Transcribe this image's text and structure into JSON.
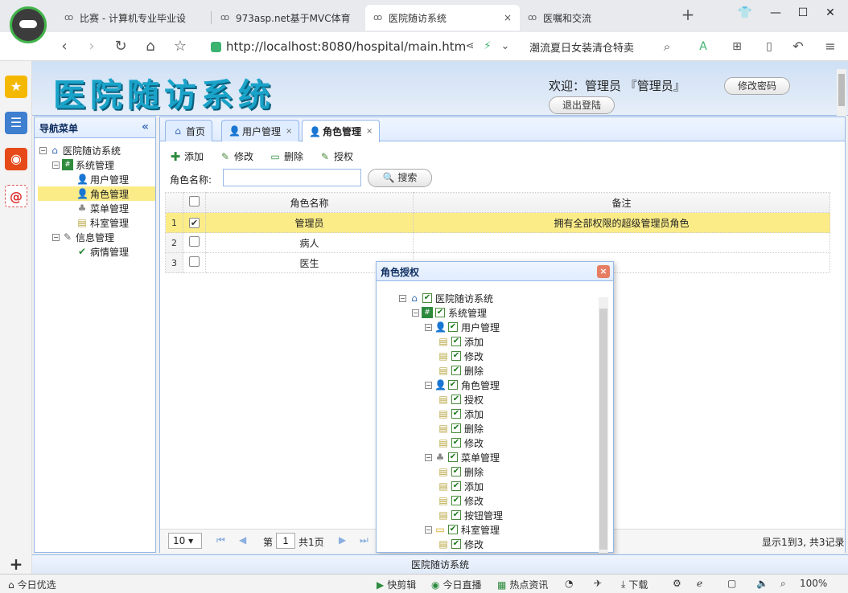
{
  "browser": {
    "tabs": [
      {
        "label": "比赛 - 计算机专业毕业设"
      },
      {
        "label": "973asp.net基于MVC体育"
      },
      {
        "label": "医院随访系统",
        "close": "×"
      },
      {
        "label": "医嘱和交流"
      }
    ],
    "new_tab": "+",
    "url": "http://localhost:8080/hospital/main.htm",
    "promo": "潮流夏日女装清仓特卖"
  },
  "app": {
    "title": "医院随访系统",
    "welcome": "欢迎：管理员 『管理员』",
    "change_password": "修改密码",
    "logout": "退出登陆",
    "footer": "医院随访系统"
  },
  "nav": {
    "header": "导航菜单",
    "collapse": "«",
    "items": [
      {
        "label": "医院随访系统"
      },
      {
        "label": "系统管理"
      },
      {
        "label": "用户管理"
      },
      {
        "label": "角色管理"
      },
      {
        "label": "菜单管理"
      },
      {
        "label": "科室管理"
      },
      {
        "label": "信息管理"
      },
      {
        "label": "病情管理"
      }
    ]
  },
  "main": {
    "tabs": [
      {
        "label": "首页"
      },
      {
        "label": "用户管理",
        "close": "×"
      },
      {
        "label": "角色管理",
        "close": "×"
      }
    ],
    "toolbar": {
      "add": "添加",
      "edit": "修改",
      "delete": "删除",
      "grant": "授权"
    },
    "search": {
      "label": "角色名称:",
      "button": "搜索",
      "value": ""
    },
    "grid": {
      "headers": [
        "角色名称",
        "备注"
      ],
      "rows": [
        {
          "num": "1",
          "name": "管理员",
          "note": "拥有全部权限的超级管理员角色",
          "checked": "✔"
        },
        {
          "num": "2",
          "name": "病人",
          "note": "",
          "checked": ""
        },
        {
          "num": "3",
          "name": "医生",
          "note": "",
          "checked": ""
        }
      ]
    },
    "pager": {
      "page_size": "10 ▾",
      "page_label": "第",
      "page": "1",
      "total_pages": "共1页",
      "summary": "显示1到3, 共3记录"
    }
  },
  "dialog": {
    "title": "角色授权",
    "close": "×",
    "tree": [
      {
        "label": "医院随访系统"
      },
      {
        "label": "系统管理"
      },
      {
        "label": "用户管理"
      },
      {
        "label": "添加"
      },
      {
        "label": "修改"
      },
      {
        "label": "删除"
      },
      {
        "label": "角色管理"
      },
      {
        "label": "授权"
      },
      {
        "label": "添加"
      },
      {
        "label": "删除"
      },
      {
        "label": "修改"
      },
      {
        "label": "菜单管理"
      },
      {
        "label": "删除"
      },
      {
        "label": "添加"
      },
      {
        "label": "修改"
      },
      {
        "label": "按钮管理"
      },
      {
        "label": "科室管理"
      },
      {
        "label": "修改"
      }
    ]
  },
  "statusbar": {
    "left": "今日优选",
    "items": [
      "快剪辑",
      "今日直播",
      "热点资讯",
      "下载",
      "100%"
    ]
  },
  "colors": {
    "accent": "#95b8e7",
    "selected_row": "#fbec88",
    "title": "#1aa3c9"
  }
}
